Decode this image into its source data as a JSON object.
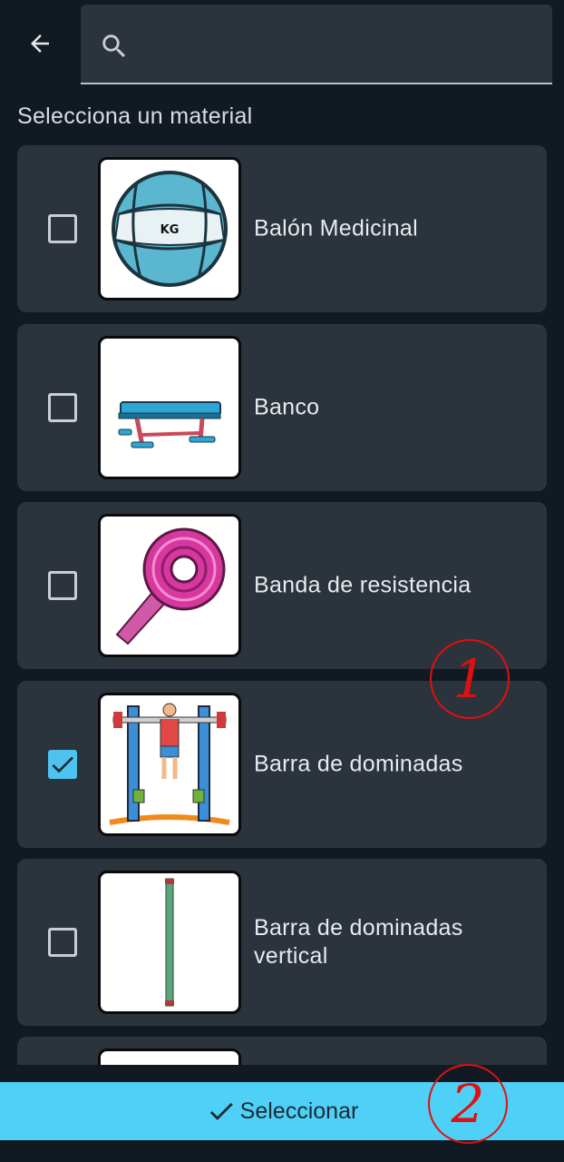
{
  "header": {
    "back_icon": "arrow-left-icon",
    "search": {
      "icon": "search-icon",
      "value": "",
      "placeholder": ""
    }
  },
  "section_label": "Selecciona un material",
  "materials": [
    {
      "label": "Balón Medicinal",
      "checked": false,
      "image": "medicine-ball"
    },
    {
      "label": "Banco",
      "checked": false,
      "image": "bench"
    },
    {
      "label": "Banda de resistencia",
      "checked": false,
      "image": "resistance-band"
    },
    {
      "label": "Barra de dominadas",
      "checked": true,
      "image": "pull-up-bar"
    },
    {
      "label": "Barra de dominadas vertical",
      "checked": false,
      "image": "vertical-bar"
    }
  ],
  "select_button": {
    "label": "Seleccionar",
    "icon": "check-icon"
  },
  "annotations": [
    "1",
    "2"
  ],
  "colors": {
    "background": "#111a22",
    "card": "#2b333c",
    "accent": "#4fd0f7",
    "annotation": "#e01010"
  }
}
